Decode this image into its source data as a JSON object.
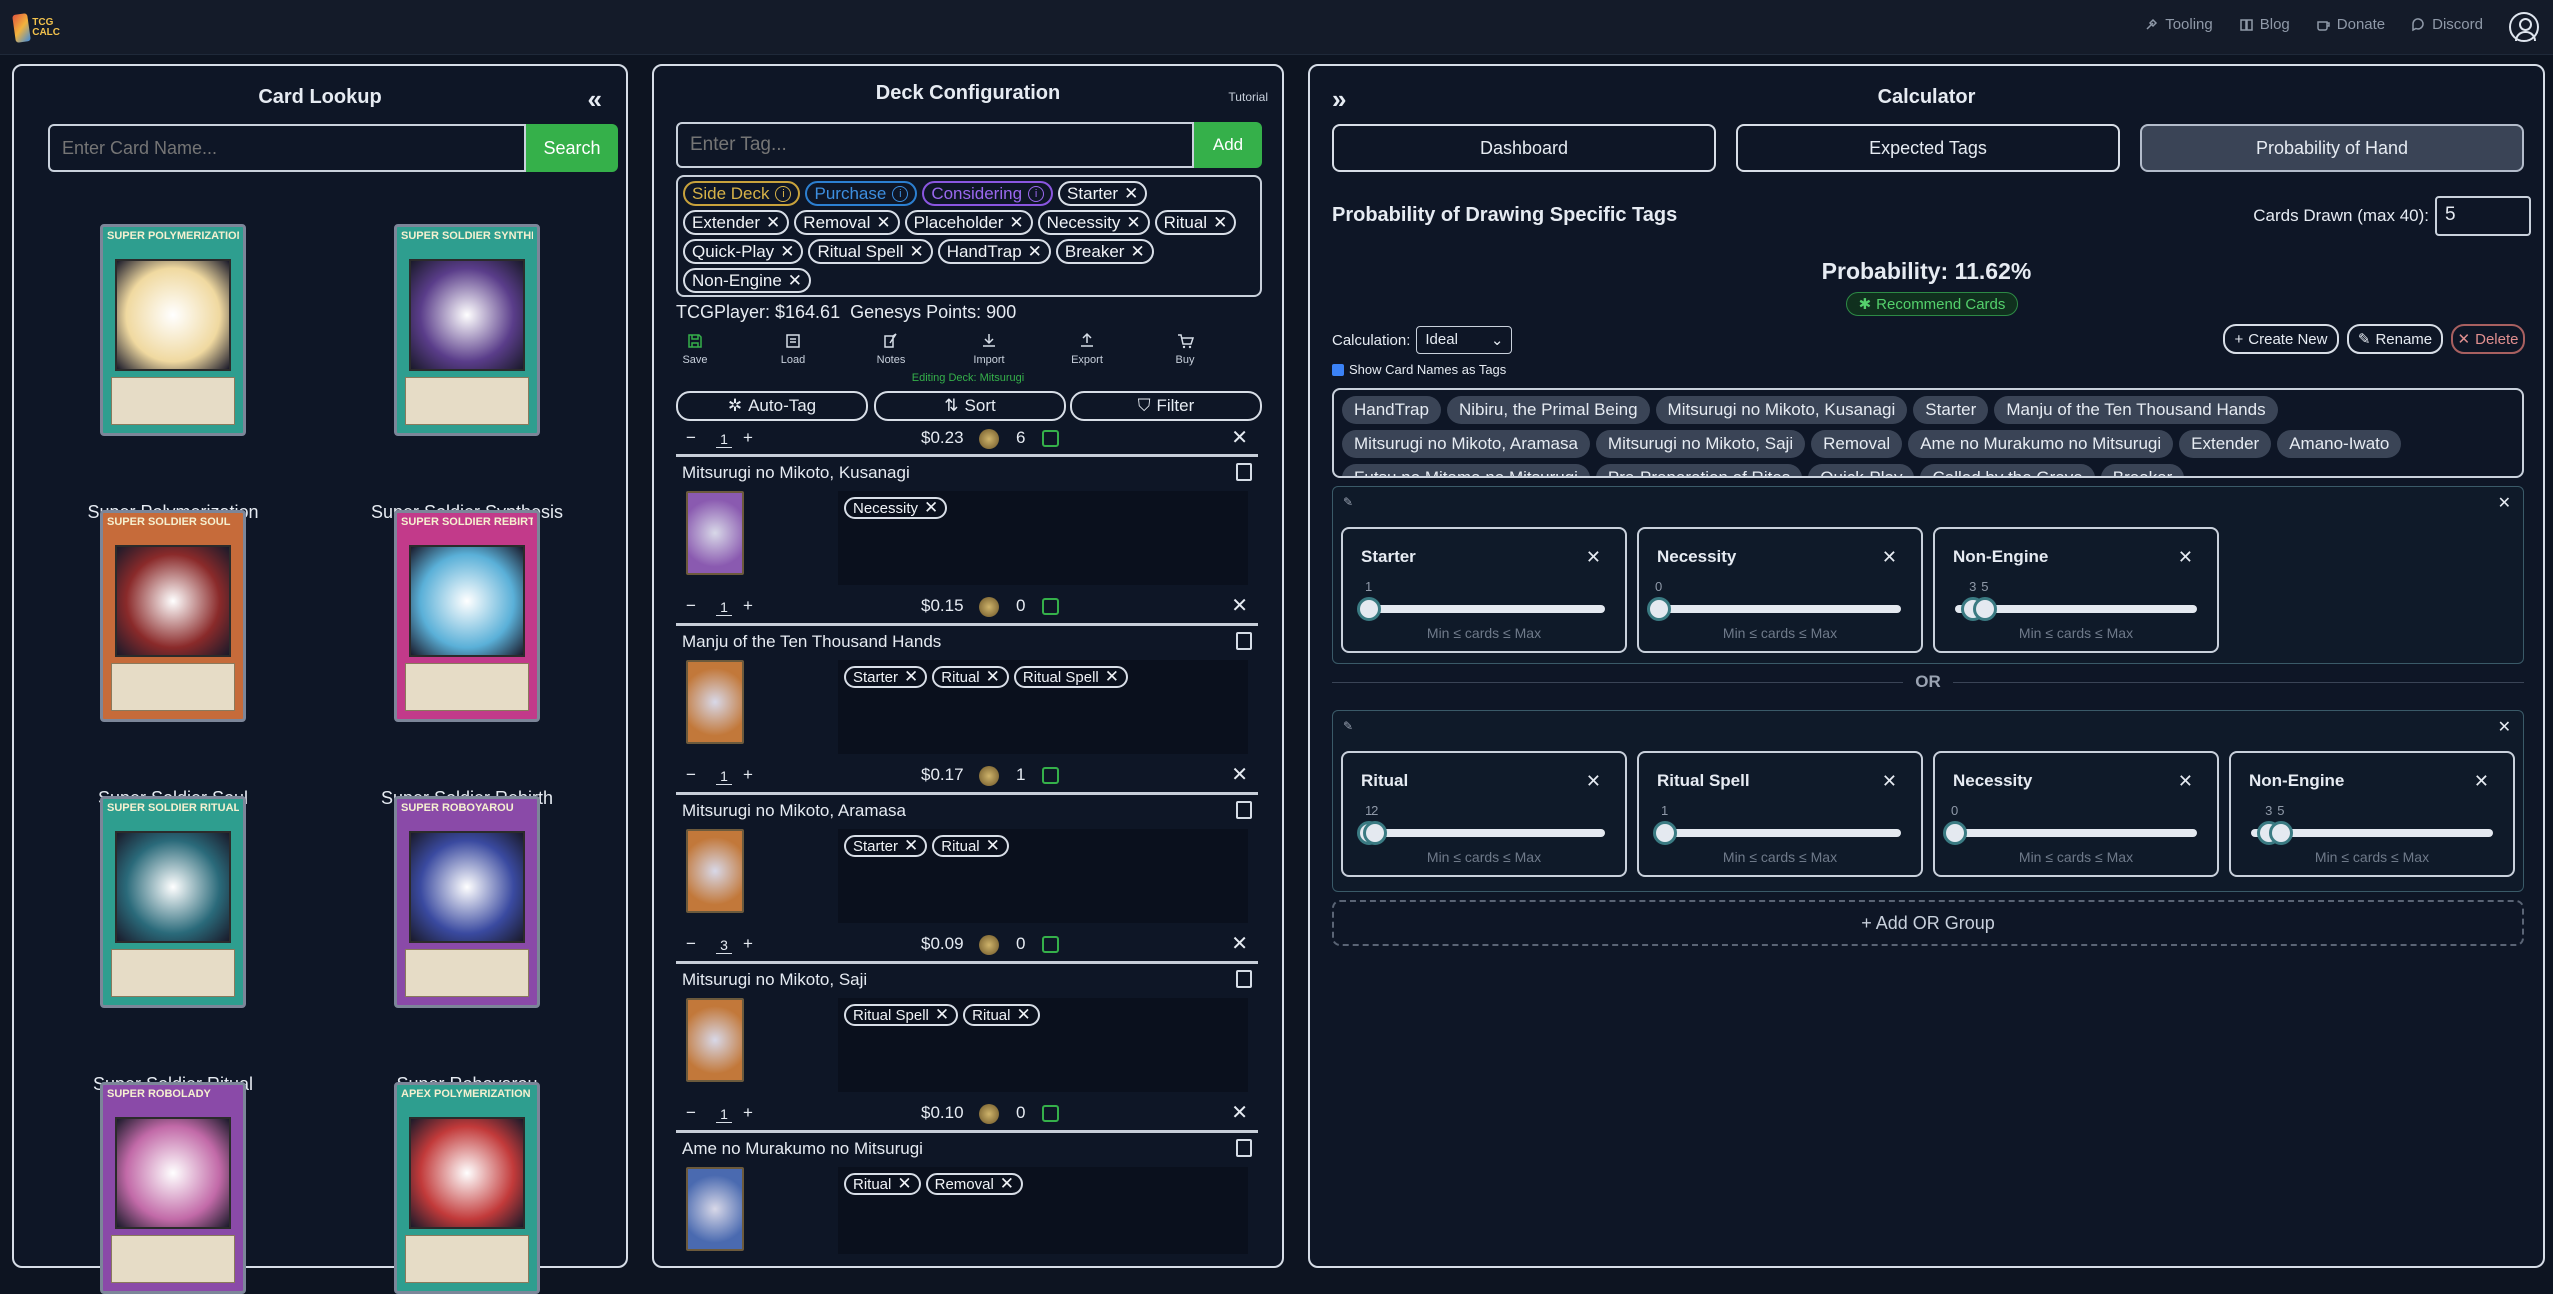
{
  "header": {
    "logo": "TCG CALC",
    "nav": [
      {
        "label": "Tooling",
        "icon": "wrench-icon"
      },
      {
        "label": "Blog",
        "icon": "book-icon"
      },
      {
        "label": "Donate",
        "icon": "coffee-icon"
      },
      {
        "label": "Discord",
        "icon": "chat-icon"
      }
    ]
  },
  "lookup": {
    "title": "Card Lookup",
    "collapse": "«",
    "placeholder": "Enter Card Name...",
    "search": "Search",
    "cards": [
      {
        "name": "Super Polymerization",
        "header": "SUPER POLYMERIZATION",
        "frame": "#2e9e8f",
        "art": "#f0d9a0"
      },
      {
        "name": "Super Soldier Synthesis",
        "header": "SUPER SOLDIER SYNTHESIS",
        "frame": "#2e9e8f",
        "art": "#5a3d8a"
      },
      {
        "name": "Super Soldier Soul",
        "header": "SUPER SOLDIER SOUL",
        "frame": "#c66b3a",
        "art": "#8a2a2a"
      },
      {
        "name": "Super Soldier Rebirth",
        "header": "SUPER SOLDIER REBIRTH",
        "frame": "#c23a8a",
        "art": "#5ab0d8"
      },
      {
        "name": "Super Soldier Ritual",
        "header": "SUPER SOLDIER RITUAL",
        "frame": "#2e9e8f",
        "art": "#2a6a7a"
      },
      {
        "name": "Super Roboyarou",
        "header": "SUPER ROBOYAROU",
        "frame": "#8a4aa8",
        "art": "#3a4aa0"
      },
      {
        "name": "",
        "header": "SUPER ROBOLADY",
        "frame": "#8a4aa8",
        "art": "#c26aa8"
      },
      {
        "name": "",
        "header": "APEX POLYMERIZATION",
        "frame": "#2e9e8f",
        "art": "#c23a3a"
      }
    ]
  },
  "deck": {
    "title": "Deck Configuration",
    "tutorial": "Tutorial",
    "placeholder": "Enter Tag...",
    "add": "Add",
    "special_tags": [
      {
        "label": "Side Deck",
        "cls": "side"
      },
      {
        "label": "Purchase",
        "cls": "purch"
      },
      {
        "label": "Considering",
        "cls": "consid"
      }
    ],
    "tags": [
      "Starter",
      "Extender",
      "Removal",
      "Placeholder",
      "Necessity",
      "Ritual",
      "Quick-Play",
      "Ritual Spell",
      "HandTrap",
      "Breaker",
      "Non-Engine"
    ],
    "tcg": "TCGPlayer: $164.61",
    "genesys": "Genesys Points: 900",
    "tools": [
      {
        "label": "Save",
        "icon": "save-icon"
      },
      {
        "label": "Load",
        "icon": "load-icon"
      },
      {
        "label": "Notes",
        "icon": "notes-icon"
      },
      {
        "label": "Import",
        "icon": "import-icon"
      },
      {
        "label": "Export",
        "icon": "export-icon"
      },
      {
        "label": "Buy",
        "icon": "cart-icon"
      }
    ],
    "editing": "Editing Deck: Mitsurugi",
    "controls": [
      {
        "label": "Auto-Tag",
        "glyph": "✲"
      },
      {
        "label": "Sort",
        "glyph": "⇅"
      },
      {
        "label": "Filter",
        "glyph": "⛉"
      }
    ],
    "top_row": {
      "qty": "1",
      "price": "$0.23",
      "gp": "6"
    },
    "rows": [
      {
        "name": "Mitsurugi no Mikoto, Kusanagi",
        "tags": [
          "Necessity"
        ],
        "qty": "1",
        "price": "$0.15",
        "gp": "0",
        "color": "#8a5ab0"
      },
      {
        "name": "Manju of the Ten Thousand Hands",
        "tags": [
          "Starter",
          "Ritual",
          "Ritual Spell"
        ],
        "qty": "1",
        "price": "$0.17",
        "gp": "1",
        "color": "#c2783a"
      },
      {
        "name": "Mitsurugi no Mikoto, Aramasa",
        "tags": [
          "Starter",
          "Ritual"
        ],
        "qty": "3",
        "price": "$0.09",
        "gp": "0",
        "color": "#c2783a"
      },
      {
        "name": "Mitsurugi no Mikoto, Saji",
        "tags": [
          "Ritual Spell",
          "Ritual"
        ],
        "qty": "1",
        "price": "$0.10",
        "gp": "0",
        "color": "#c2783a"
      },
      {
        "name": "Ame no Murakumo no Mitsurugi",
        "tags": [
          "Ritual",
          "Removal"
        ],
        "qty": "",
        "price": "",
        "gp": "",
        "color": "#4a6ab0"
      }
    ]
  },
  "calc": {
    "title": "Calculator",
    "expand": "»",
    "tabs": [
      "Dashboard",
      "Expected Tags",
      "Probability of Hand"
    ],
    "section": "Probability of Drawing Specific Tags",
    "drawn_label": "Cards Drawn (max 40):",
    "drawn": "5",
    "probability": "Probability: 11.62%",
    "recommend": "Recommend Cards",
    "calc_label": "Calculation:",
    "calc_value": "Ideal",
    "create": "Create New",
    "rename": "Rename",
    "delete": "Delete",
    "show_names": "Show Card Names as Tags",
    "name_tags": [
      "HandTrap",
      "Nibiru, the Primal Being",
      "Mitsurugi no Mikoto, Kusanagi",
      "Starter",
      "Manju of the Ten Thousand Hands",
      "Mitsurugi no Mikoto, Aramasa",
      "Mitsurugi no Mikoto, Saji",
      "Removal",
      "Ame no Murakumo no Mitsurugi",
      "Extender",
      "Amano-Iwato",
      "Futsu no Mitama no Mitsurugi",
      "Pre-Preparation of Rites",
      "Quick-Play",
      "Called by the Grave",
      "Breaker"
    ],
    "or": "OR",
    "hint": "Min ≤ cards ≤ Max",
    "add_group": "+ Add OR Group",
    "groups": [
      {
        "slots": [
          {
            "name": "Starter",
            "min": 1,
            "max": 1,
            "min_label": "1",
            "max_label": ""
          },
          {
            "name": "Necessity",
            "min": 0,
            "max": 0,
            "min_label": "0",
            "max_label": ""
          },
          {
            "name": "Non-Engine",
            "min": 3,
            "max": 5,
            "min_label": "3",
            "max_label": "5"
          }
        ]
      },
      {
        "slots": [
          {
            "name": "Ritual",
            "min": 1,
            "max": 2,
            "min_label": "1",
            "max_label": "2"
          },
          {
            "name": "Ritual Spell",
            "min": 1,
            "max": 1,
            "min_label": "1",
            "max_label": ""
          },
          {
            "name": "Necessity",
            "min": 0,
            "max": 0,
            "min_label": "0",
            "max_label": ""
          },
          {
            "name": "Non-Engine",
            "min": 3,
            "max": 5,
            "min_label": "3",
            "max_label": "5"
          }
        ]
      }
    ],
    "slider_max": 40,
    "colors": {
      "accent": "#35b04a",
      "active_tab": "#3a4456"
    }
  }
}
